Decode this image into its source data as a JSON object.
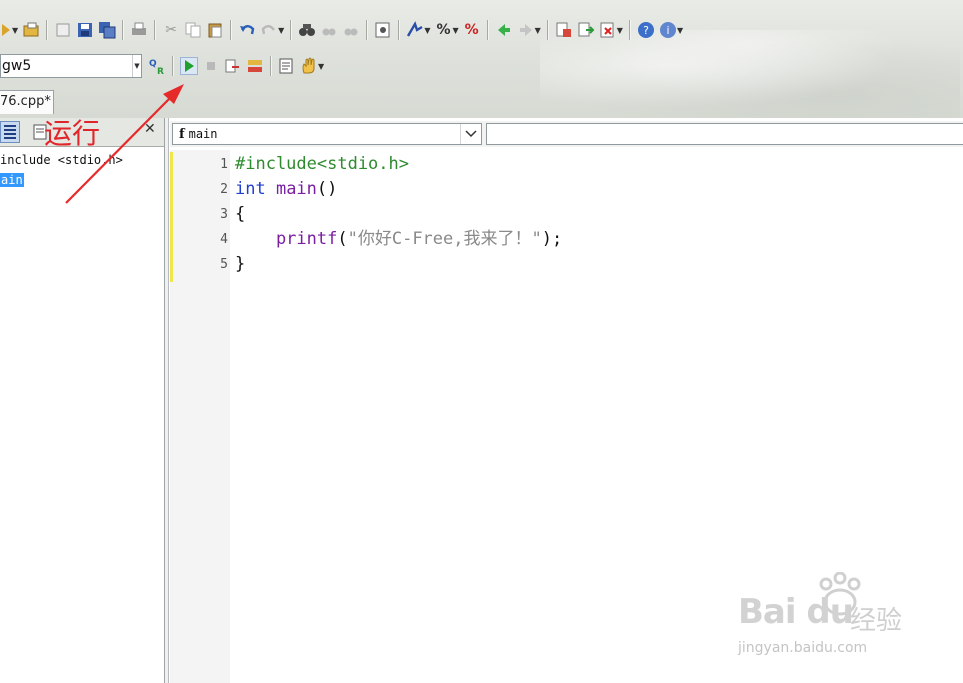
{
  "compiler": {
    "value": "gw5"
  },
  "file_tab": {
    "label": "76.cpp*"
  },
  "outline": {
    "items": [
      {
        "text": "include <stdio.h>",
        "selected": false
      },
      {
        "text": "ain",
        "selected": true
      }
    ]
  },
  "function_selector": {
    "badge": "f",
    "value": "main"
  },
  "editor": {
    "lines": [
      {
        "num": "1",
        "tokens": [
          {
            "t": "#include<stdio.h>",
            "c": "c-pre"
          }
        ]
      },
      {
        "num": "2",
        "tokens": [
          {
            "t": "int",
            "c": "c-kw"
          },
          {
            "t": " main",
            "c": "c-fn"
          },
          {
            "t": "()",
            "c": "c-pl"
          }
        ]
      },
      {
        "num": "3",
        "tokens": [
          {
            "t": "{",
            "c": "c-pl"
          }
        ]
      },
      {
        "num": "4",
        "tokens": [
          {
            "t": "    printf",
            "c": "c-fn"
          },
          {
            "t": "(",
            "c": "c-pl"
          },
          {
            "t": "\"你好C-Free,我来了！\"",
            "c": "c-str"
          },
          {
            "t": ");",
            "c": "c-pl"
          }
        ]
      },
      {
        "num": "5",
        "tokens": [
          {
            "t": "}",
            "c": "c-pl"
          }
        ]
      }
    ]
  },
  "annotation": {
    "text": "运行",
    "color": "#e0262a"
  },
  "watermark": {
    "brand": "Bai du",
    "suffix": "经验",
    "url": "jingyan.baidu.com"
  },
  "toolbar_icons": [
    "new-file-icon",
    "open-folder-icon",
    "close-file-icon",
    "save-icon",
    "save-all-icon",
    "print-icon",
    "cut-icon",
    "copy-icon",
    "paste-icon",
    "undo-icon",
    "redo-icon",
    "find-icon",
    "find-next-icon",
    "find-previous-icon",
    "replace-icon",
    "bookmark-icon",
    "toggle-comment-icon",
    "uncomment-icon",
    "back-icon",
    "forward-icon",
    "project-icon",
    "export-icon",
    "close-project-icon",
    "help-icon",
    "about-icon"
  ],
  "toolbar2_icons": [
    "compile-icon",
    "run-icon",
    "stop-icon",
    "step-over-icon",
    "step-into-icon",
    "build-log-icon",
    "hand-icon"
  ]
}
